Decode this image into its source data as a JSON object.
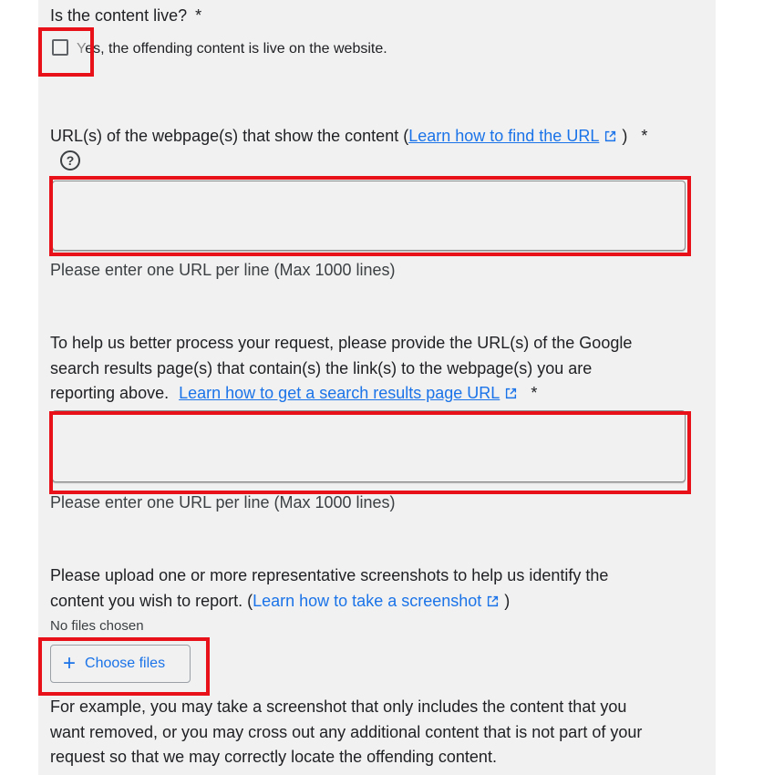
{
  "content_live": {
    "question": "Is the content live?",
    "required_mark": "*",
    "checkbox_label_first": "Y",
    "checkbox_label_rest": "es, the offending content is live on the website."
  },
  "url_field": {
    "label": "URL(s) of the webpage(s) that show the content (",
    "link_text": "Learn how to find the URL",
    "label_close": ")",
    "required_mark": "*",
    "help_symbol": "?",
    "value": "",
    "hint": "Please enter one URL per line (Max 1000 lines)"
  },
  "search_url_field": {
    "label_line1": "To help us better process your request, please provide the URL(s) of the Google",
    "label_line2": "search results page(s) that contain(s) the link(s) to the webpage(s) you are",
    "label_line3": "reporting above.",
    "link_text": "Learn how to get a search results page URL",
    "required_mark": "*",
    "value": "",
    "hint": "Please enter one URL per line (Max 1000 lines)"
  },
  "screenshot_upload": {
    "label_line1": "Please upload one or more representative screenshots to help us identify the",
    "label_line2": "content you wish to report. (",
    "link_text": "Learn how to take a screenshot",
    "label_close": ")",
    "status": "No files chosen",
    "button_icon": "+",
    "button_label": "Choose files",
    "example_line1": "For example, you may take a screenshot that only includes the content that you",
    "example_line2": "want removed, or you may cross out any additional content that is not part of your",
    "example_line3": "request so that we may correctly locate the offending content."
  },
  "icons": {
    "external_link": "external-link-icon",
    "help": "help-circle-icon",
    "add": "plus-icon"
  },
  "colors": {
    "link": "#1a73e8",
    "highlight": "#e8111a",
    "panel_bg": "#f1f1f1"
  }
}
